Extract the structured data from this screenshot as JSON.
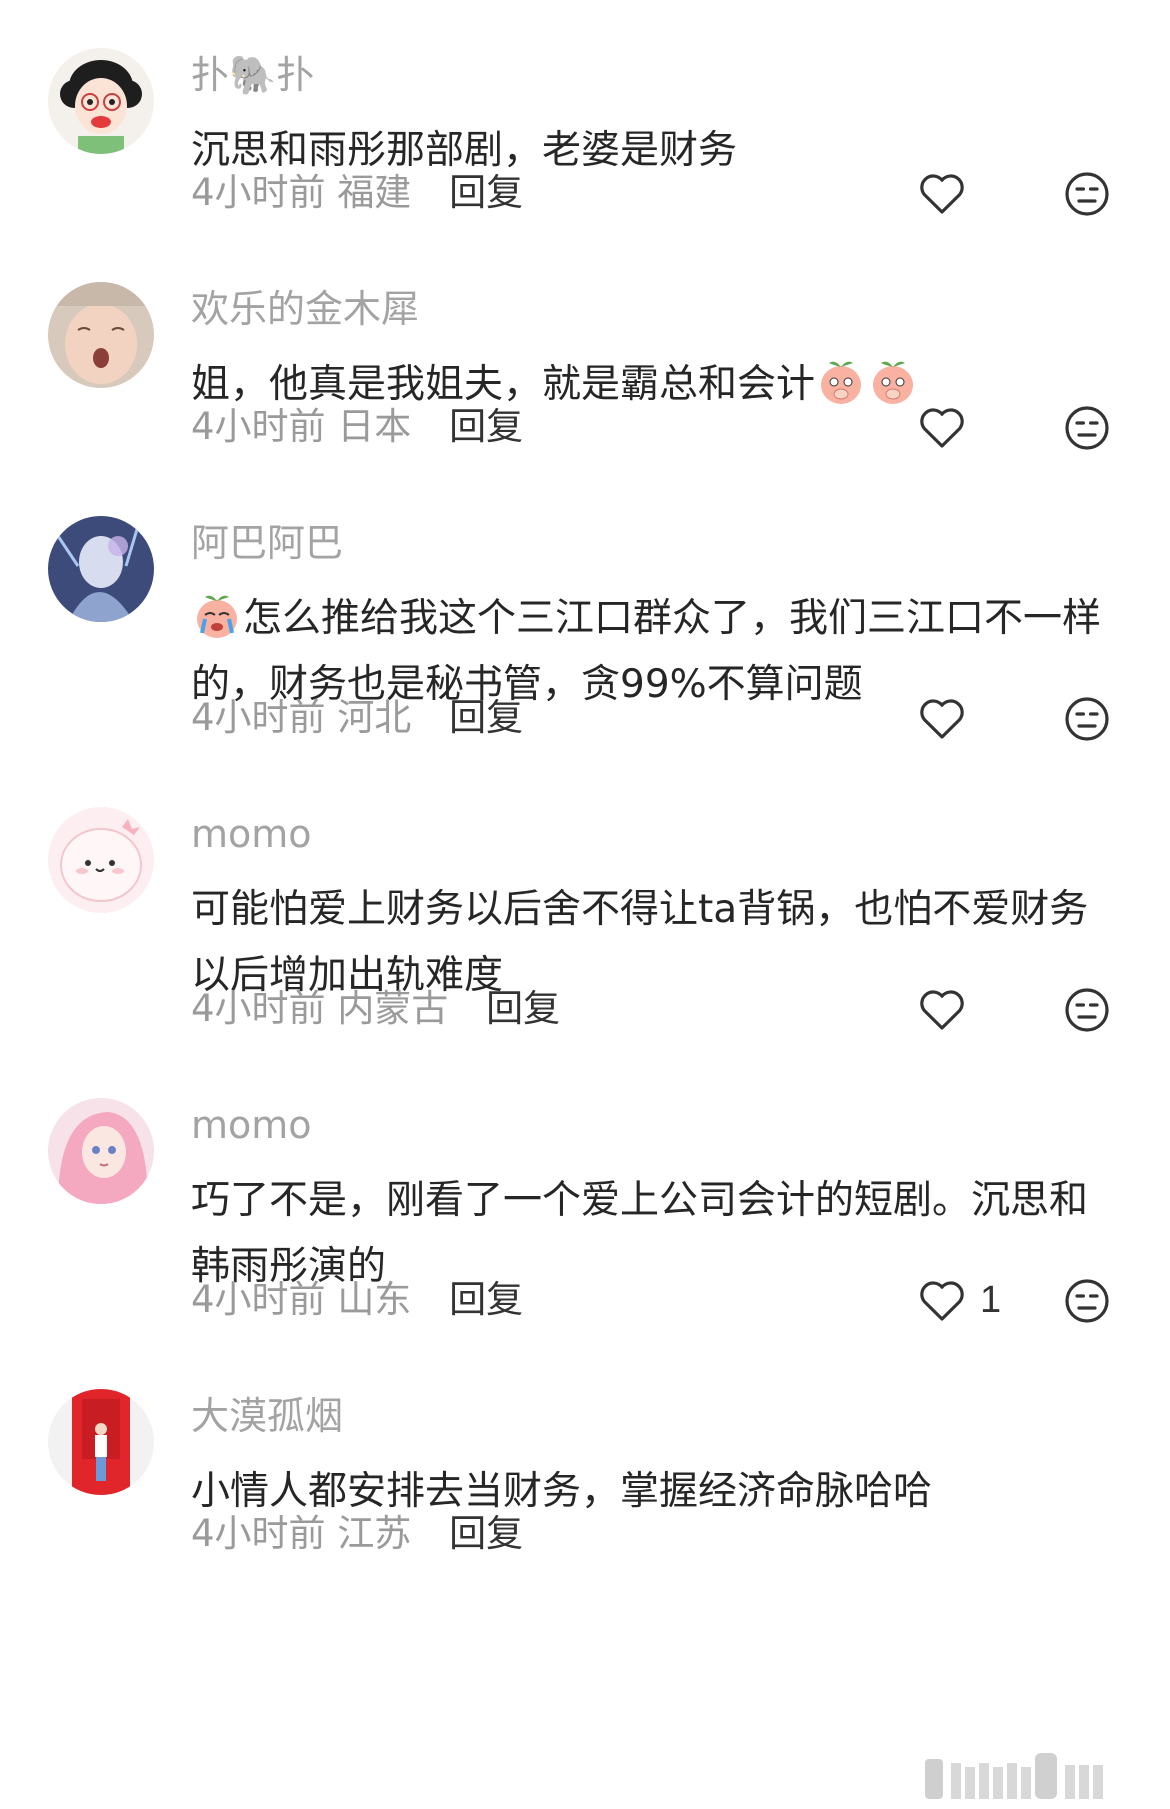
{
  "comments": [
    {
      "username": "扑🐘扑",
      "text": "沉思和雨彤那部剧，老婆是财务",
      "time": "4小时前",
      "location": "福建",
      "reply_label": "回复",
      "likes": ""
    },
    {
      "username": "欢乐的金木犀",
      "text": "姐，他真是我姐夫，就是霸总和会计",
      "time": "4小时前",
      "location": "日本",
      "reply_label": "回复",
      "likes": ""
    },
    {
      "username": "阿巴阿巴",
      "text": "怎么推给我这个三江口群众了，我们三江口不一样的，财务也是秘书管，贪99%不算问题",
      "time": "4小时前",
      "location": "河北",
      "reply_label": "回复",
      "likes": ""
    },
    {
      "username": "momo",
      "text": "可能怕爱上财务以后舍不得让ta背锅，也怕不爱财务以后增加出轨难度",
      "time": "4小时前",
      "location": "内蒙古",
      "reply_label": "回复",
      "likes": ""
    },
    {
      "username": "momo",
      "text": "巧了不是，刚看了一个爱上公司会计的短剧。沉思和韩雨彤演的",
      "time": "4小时前",
      "location": "山东",
      "reply_label": "回复",
      "likes": "1"
    },
    {
      "username": "大漠孤烟",
      "text": "小情人都安排去当财务，掌握经济命脉哈哈",
      "time": "4小时前",
      "location": "江苏",
      "reply_label": "回复",
      "likes": ""
    }
  ],
  "icons": {
    "like": "heart-outline-icon",
    "dislike": "unamused-face-icon",
    "emoji_peach": "peach-covering-mouth-emoji",
    "emoji_cry": "crying-peach-emoji"
  },
  "colors": {
    "username": "#a3a3a3",
    "text": "#262626",
    "meta": "#9a9a9a",
    "icon": "#333333"
  }
}
